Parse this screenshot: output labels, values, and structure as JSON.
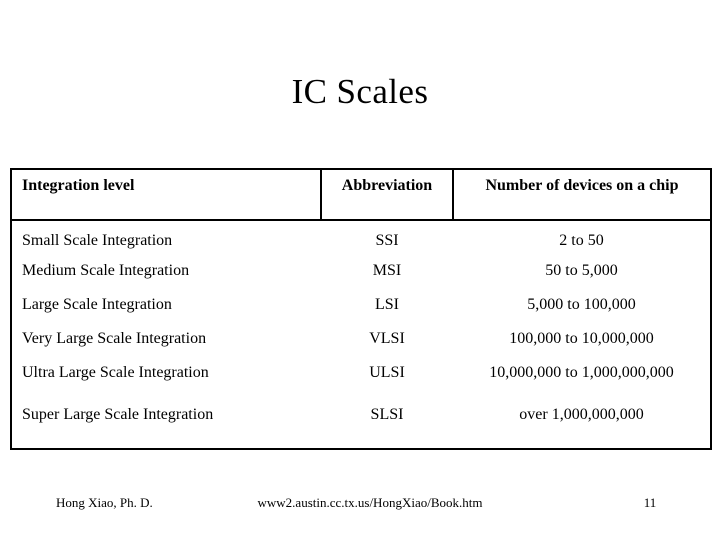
{
  "slide": {
    "title": "IC Scales"
  },
  "table": {
    "headers": {
      "level": "Integration level",
      "abbreviation": "Abbreviation",
      "devices": "Number of devices on a chip"
    },
    "rows": [
      {
        "level": "Small Scale Integration",
        "abbreviation": "SSI",
        "devices": "2 to 50"
      },
      {
        "level": "Medium Scale Integration",
        "abbreviation": "MSI",
        "devices": "50 to 5,000"
      },
      {
        "level": "Large Scale Integration",
        "abbreviation": "LSI",
        "devices": "5,000 to 100,000"
      },
      {
        "level": "Very Large Scale Integration",
        "abbreviation": "VLSI",
        "devices": "100,000 to 10,000,000"
      },
      {
        "level": "Ultra Large Scale Integration",
        "abbreviation": "ULSI",
        "devices": "10,000,000 to 1,000,000,000"
      },
      {
        "level": "Super Large Scale Integration",
        "abbreviation": "SLSI",
        "devices": "over 1,000,000,000"
      }
    ]
  },
  "footer": {
    "author": "Hong Xiao, Ph. D.",
    "url": "www2.austin.cc.tx.us/HongXiao/Book.htm",
    "page_number": "11"
  },
  "colors": {
    "background": "#ffffff",
    "text": "#000000",
    "border": "#000000"
  }
}
